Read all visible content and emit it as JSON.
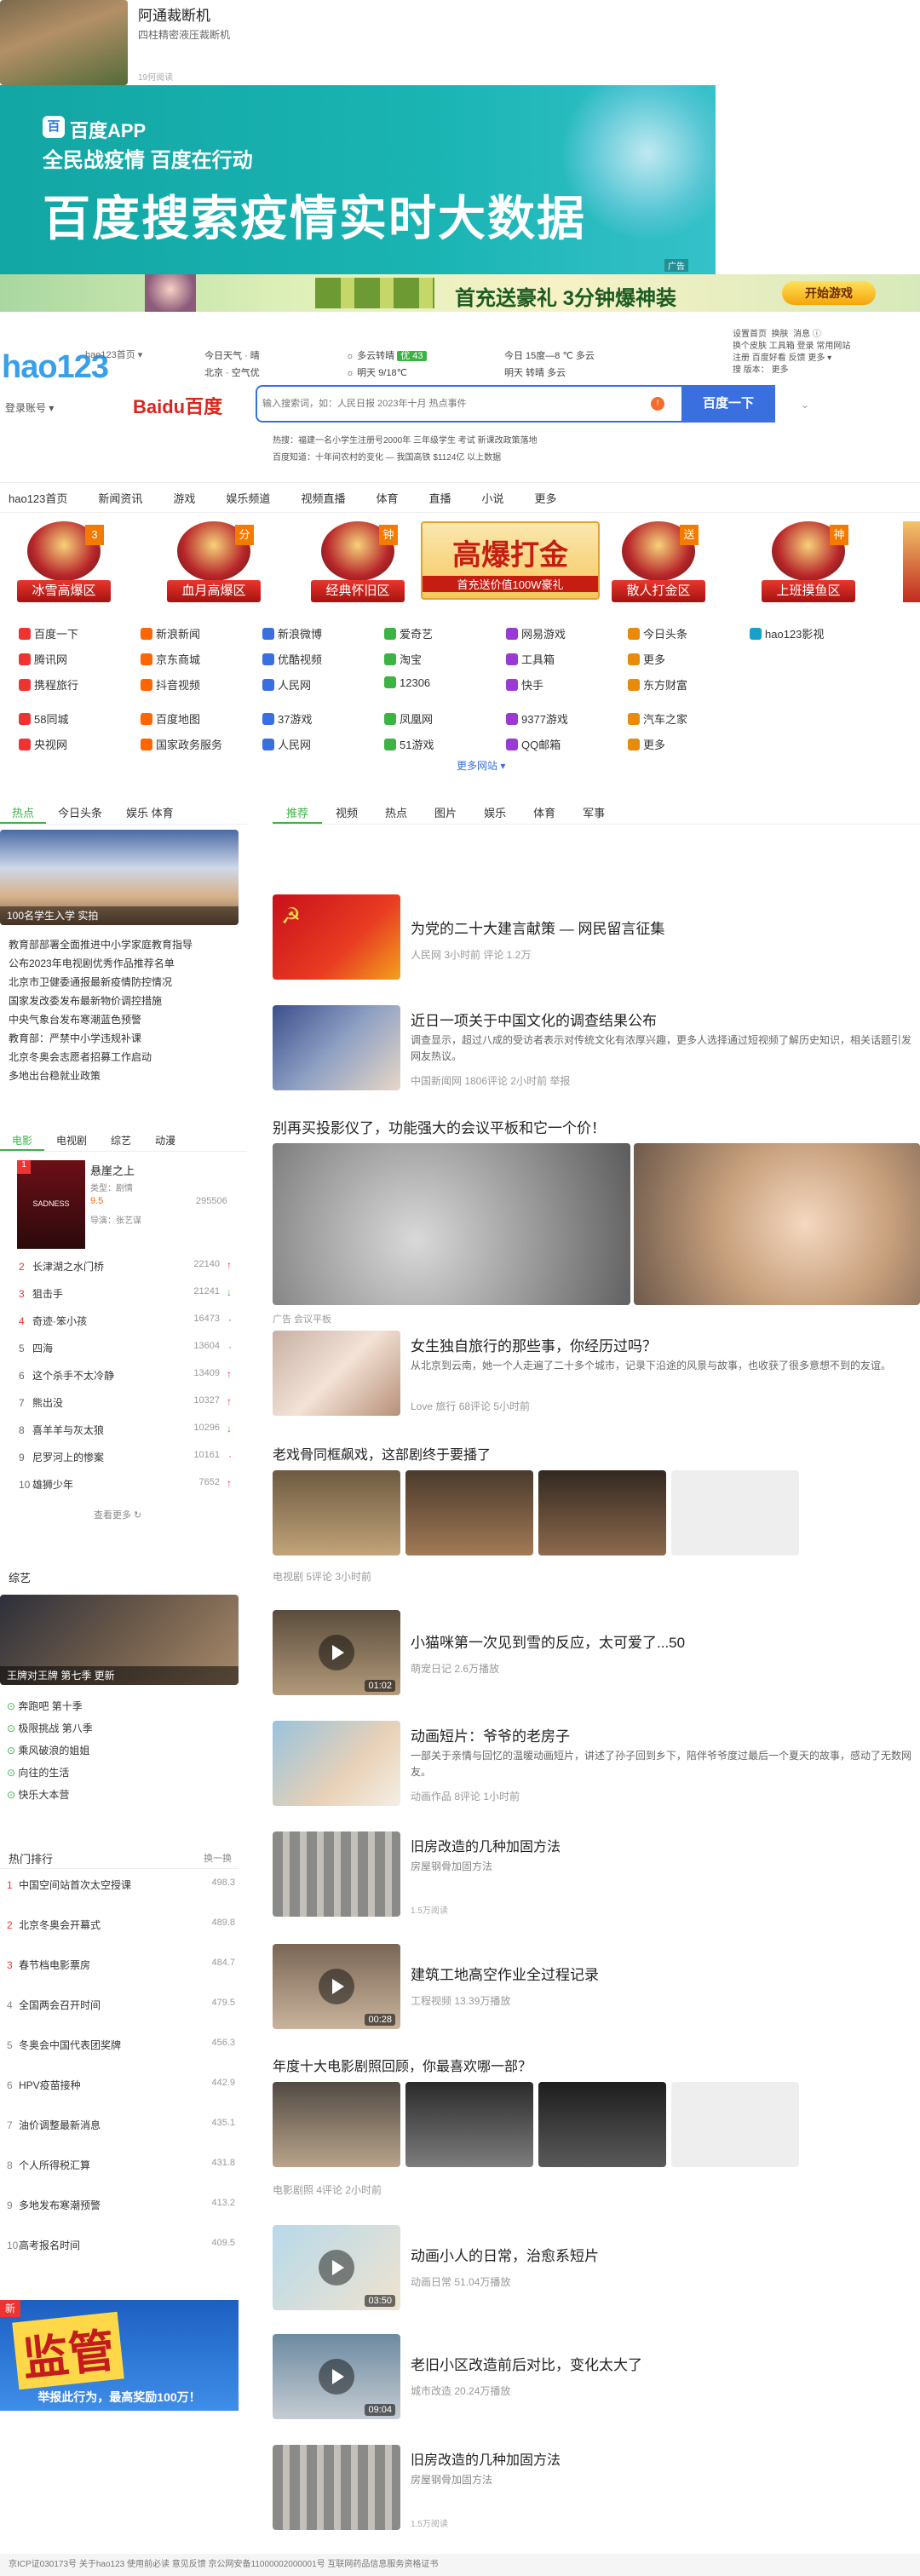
{
  "top_news": {
    "title": "阿通裁断机",
    "subtitle": "四柱精密液压裁断机",
    "reads": "19何阅读"
  },
  "baidu_banner": {
    "app_name": "百度APP",
    "slogan": "全民战疫情 百度在行动",
    "headline": "百度搜索疫情实时大数据",
    "ad_tag": "广告"
  },
  "game_banner": {
    "text": "首充送豪礼 3分钟爆神装",
    "button": "开始游戏"
  },
  "header": {
    "logo": "hao123",
    "logo_sub": "hao123首页 ▾",
    "user": "登录账号 ▾",
    "weather": {
      "col1_r1": "今日天气 · 晴",
      "col1_r2": "北京 · 空气优",
      "col2_r1": "☼ 多云转晴",
      "col2_r2": "☼ 明天 9/18℃",
      "aqi": "优 43",
      "col3_r1": "今日 15度—8 ℃  多云",
      "col3_r2": "明天 转晴  多云"
    },
    "right": {
      "r1a": "设置首页",
      "r1b": "换肤",
      "r1c": "消息  ⓘ",
      "r2a": "换个皮肤",
      "r2b": "工具箱",
      "r2c": "登录",
      "r2d": "常用网站",
      "r3a": "注册",
      "r3b": "百度好看",
      "r3c": "反馈",
      "r3d": "更多 ▾",
      "r4a": "搜 版本：",
      "r4b": "更多"
    }
  },
  "search": {
    "engine": "Baidu百度",
    "placeholder": "输入搜索词，如：人民日报 2023年十月 热点事件",
    "button": "百度一下",
    "hint1": "热搜：福建一名小学生注册号2000年  三年级学生  考试  新课改政策落地",
    "hint2": "百度知道：十年间农村的变化 — 我国高铁 $1124亿  以上数据"
  },
  "nav": {
    "items": [
      "hao123首页",
      "新闻资讯",
      "游戏",
      "娱乐频道",
      "视频直播",
      "体育",
      "直播",
      "小说",
      "更多"
    ]
  },
  "games": [
    {
      "label": "冰雪高爆区",
      "tag": "3"
    },
    {
      "label": "血月高爆区",
      "tag": "分"
    },
    {
      "label": "经典怀旧区",
      "tag": "钟"
    },
    {
      "label": "散人打金区",
      "tag": "送"
    },
    {
      "label": "上班摸鱼区",
      "tag": "神"
    }
  ],
  "game_promo": {
    "title": "高爆打金",
    "sub": "首充送价值100W豪礼"
  },
  "sites": {
    "row1": [
      "百度一下",
      "新浪新闻",
      "新浪微博",
      "爱奇艺",
      "网易游戏",
      "今日头条",
      "hao123影视"
    ],
    "row2": [
      "腾讯网",
      "京东商城",
      "优酷视频",
      "淘宝",
      "工具箱",
      "更多"
    ],
    "row3": [
      "携程旅行",
      "抖音视频",
      "人民网",
      "12306",
      "快手",
      "东方财富"
    ],
    "row4": [
      "58同城",
      "百度地图",
      "37游戏",
      "凤凰网",
      "9377游戏",
      "汽车之家"
    ],
    "row5": [
      "央视网",
      "国家政务服务",
      "人民网",
      "51游戏",
      "QQ邮箱",
      "更多"
    ],
    "more": "更多网站 ▾"
  },
  "left": {
    "tabs": [
      "热点",
      "今日头条",
      "娱乐 体育"
    ],
    "hero_caption": "100名学生入学 实拍",
    "news": [
      "教育部部署全面推进中小学家庭教育指导",
      "公布2023年电视剧优秀作品推荐名单",
      "北京市卫健委通报最新疫情防控情况",
      "国家发改委发布最新物价调控措施",
      "中央气象台发布寒潮蓝色预警",
      "教育部：严禁中小学违规补课",
      "北京冬奥会志愿者招募工作启动",
      "多地出台稳就业政策"
    ],
    "movie_tabs": [
      "电影",
      "电视剧",
      "综艺",
      "动漫"
    ],
    "movie": {
      "title": "悬崖之上",
      "sub": "类型：剧情",
      "score": "9.5",
      "heat": "295506",
      "sub2": "导演：张艺谋"
    },
    "ranks": [
      {
        "n": "2",
        "t": "长津湖之水门桥",
        "v": "22140",
        "a": "↑",
        "g": false
      },
      {
        "n": "3",
        "t": "狙击手",
        "v": "21241",
        "a": "↓",
        "g": false
      },
      {
        "n": "4",
        "t": "奇迹·笨小孩",
        "v": "16473",
        "a": "·",
        "g": false
      },
      {
        "n": "5",
        "t": "四海",
        "v": "13604",
        "a": "·",
        "g": true
      },
      {
        "n": "6",
        "t": "这个杀手不太冷静",
        "v": "13409",
        "a": "↑",
        "g": true
      },
      {
        "n": "7",
        "t": "熊出没",
        "v": "10327",
        "a": "↑",
        "g": true
      },
      {
        "n": "8",
        "t": "喜羊羊与灰太狼",
        "v": "10296",
        "a": "↓",
        "g": true
      },
      {
        "n": "9",
        "t": "尼罗河上的惨案",
        "v": "10161",
        "a": "·",
        "g": true
      },
      {
        "n": "10",
        "t": "雄狮少年",
        "v": "7652",
        "a": "↑",
        "g": true
      }
    ],
    "rank_more": "查看更多 ↻",
    "section_title": "综艺",
    "variety_caption": "王牌对王牌 第七季 更新",
    "variety_list": [
      "奔跑吧 第十季",
      "极限挑战 第八季",
      "乘风破浪的姐姐",
      "向往的生活",
      "快乐大本营"
    ],
    "hot_header": "热门排行",
    "hot_more": "换一换",
    "hot": [
      {
        "n": "1",
        "t": "中国空间站首次太空授课",
        "v": "498.3"
      },
      {
        "n": "2",
        "t": "北京冬奥会开幕式",
        "v": "489.8"
      },
      {
        "n": "3",
        "t": "春节档电影票房",
        "v": "484.7"
      },
      {
        "n": "4",
        "t": "全国两会召开时间",
        "v": "479.5"
      },
      {
        "n": "5",
        "t": "冬奥会中国代表团奖牌",
        "v": "456.3"
      },
      {
        "n": "6",
        "t": "HPV疫苗接种",
        "v": "442.9"
      },
      {
        "n": "7",
        "t": "油价调整最新消息",
        "v": "435.1"
      },
      {
        "n": "8",
        "t": "个人所得税汇算",
        "v": "431.8"
      },
      {
        "n": "9",
        "t": "多地发布寒潮预警",
        "v": "413.2"
      },
      {
        "n": "10",
        "t": "高考报名时间",
        "v": "409.5"
      }
    ],
    "ad_title": "监管",
    "ad_sub": "举报此行为，最高奖励100万！",
    "ad_new": "新"
  },
  "feed": {
    "tabs": [
      "推荐",
      "视频",
      "热点",
      "图片",
      "娱乐",
      "体育",
      "军事"
    ],
    "items": [
      {
        "title": "为党的二十大建言献策 — 网民留言征集",
        "meta": "人民网  3小时前  评论 1.2万"
      },
      {
        "title": "近日一项关于中国文化的调查结果公布",
        "desc": "调查显示，超过八成的受访者表示对传统文化有浓厚兴趣，更多人选择通过短视频了解历史知识，相关话题引发网友热议。",
        "meta": "中国新闻网  1806评论  2小时前  举报"
      },
      {
        "title": "别再买投影仪了，功能强大的会议平板和它一个价！",
        "meta": "广告  会议平板"
      },
      {
        "title": "女生独自旅行的那些事，你经历过吗？",
        "desc": "从北京到云南，她一个人走遍了二十多个城市，记录下沿途的风景与故事，也收获了很多意想不到的友谊。",
        "meta": "Love  旅行  68评论  5小时前"
      },
      {
        "title": "老戏骨同框飙戏，这部剧终于要播了",
        "meta": "电视剧  5评论  3小时前"
      },
      {
        "title": "小猫咪第一次见到雪的反应，太可爱了...50",
        "meta": "萌宠日记  2.6万播放",
        "dur": "01:02"
      },
      {
        "title": "动画短片：爷爷的老房子",
        "desc": "一部关于亲情与回忆的温暖动画短片，讲述了孙子回到乡下，陪伴爷爷度过最后一个夏天的故事，感动了无数网友。",
        "meta": "动画作品  8评论  1小时前"
      },
      {
        "title": "旧房改造的几种加固方法",
        "sub": "房屋钢骨加固方法",
        "meta": "1.5万阅读"
      },
      {
        "title": "建筑工地高空作业全过程记录",
        "meta": "工程视频  13.39万播放",
        "dur": "00:28"
      },
      {
        "title": "年度十大电影剧照回顾，你最喜欢哪一部？",
        "meta": "电影剧照  4评论  2小时前"
      },
      {
        "title": "动画小人的日常，治愈系短片",
        "meta": "动画日常  51.04万播放",
        "dur": "03:50"
      },
      {
        "title": "老旧小区改造前后对比，变化太大了",
        "meta": "城市改造  20.24万播放",
        "dur": "09:04"
      },
      {
        "title": "旧房改造的几种加固方法",
        "sub": "房屋钢骨加固方法",
        "meta": "1.5万阅读"
      }
    ]
  },
  "footer": "京ICP证030173号  关于hao123  使用前必读  意见反馈  京公网安备11000002000001号  互联网药品信息服务资格证书"
}
